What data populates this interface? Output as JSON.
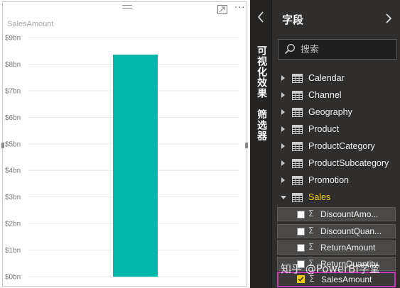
{
  "visual": {
    "title": "SalesAmount",
    "icons": [
      "drag-grip-icon",
      "focus-mode-icon",
      "more-options-icon"
    ]
  },
  "chart_data": {
    "type": "bar",
    "title": "SalesAmount",
    "categories": [
      ""
    ],
    "series": [
      {
        "values": [
          8.36
        ]
      }
    ],
    "ylim": [
      0,
      9
    ],
    "y_unit": "bn",
    "yticks": [
      "$0bn",
      "$1bn",
      "$2bn",
      "$3bn",
      "$4bn",
      "$5bn",
      "$6bn",
      "$7bn",
      "$8bn",
      "$9bn"
    ],
    "grid": true,
    "bar_color": "#01b8aa"
  },
  "collapsed_panes": {
    "tabs": [
      "可视化效果",
      "筛选器"
    ]
  },
  "fields_pane": {
    "title": "字段",
    "search_placeholder": "搜索",
    "tables": [
      {
        "name": "Calendar",
        "expanded": false
      },
      {
        "name": "Channel",
        "expanded": false
      },
      {
        "name": "Geography",
        "expanded": false
      },
      {
        "name": "Product",
        "expanded": false
      },
      {
        "name": "ProductCategory",
        "expanded": false
      },
      {
        "name": "ProductSubcategory",
        "expanded": false
      },
      {
        "name": "Promotion",
        "expanded": false
      },
      {
        "name": "Sales",
        "expanded": true
      }
    ],
    "fields": [
      {
        "name": "DiscountAmo...",
        "checked": false
      },
      {
        "name": "DiscountQuan...",
        "checked": false
      },
      {
        "name": "ReturnAmount",
        "checked": false
      },
      {
        "name": "ReturnQuantity",
        "checked": false
      },
      {
        "name": "SalesAmount",
        "checked": true
      }
    ]
  },
  "watermark": "知乎 @PowerBI学堂",
  "colors": {
    "accent_yellow": "#f2c811",
    "highlight_magenta": "#c239b3",
    "bar_teal": "#01b8aa",
    "pane_dark": "#2f2e2d"
  }
}
